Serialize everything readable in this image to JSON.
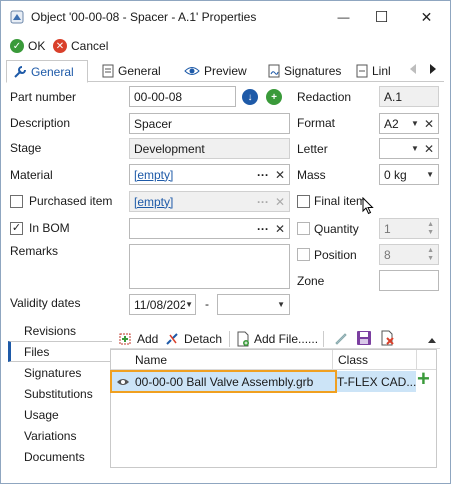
{
  "window": {
    "title": "Object '00-00-08 - Spacer - A.1' Properties",
    "minimize_glyph": "—",
    "maximize_glyph": "☐",
    "close_glyph": "✕"
  },
  "toolbar": {
    "ok_label": "OK",
    "cancel_label": "Cancel"
  },
  "tabs": [
    {
      "label": "General",
      "active": true,
      "icon": "wrench-icon"
    },
    {
      "label": "General",
      "active": false,
      "icon": "document-icon"
    },
    {
      "label": "Preview",
      "active": false,
      "icon": "eye-icon"
    },
    {
      "label": "Signatures",
      "active": false,
      "icon": "signature-icon"
    },
    {
      "label": "Linl",
      "active": false,
      "icon": "link-icon"
    }
  ],
  "form": {
    "part_number_label": "Part number",
    "part_number_value": "00-00-08",
    "description_label": "Description",
    "description_value": "Spacer",
    "stage_label": "Stage",
    "stage_value": "Development",
    "material_label": "Material",
    "material_value": "[empty]",
    "purchased_label": "Purchased item",
    "purchased_value": "[empty]",
    "in_bom_label": "In BOM",
    "remarks_label": "Remarks",
    "validity_label": "Validity dates",
    "validity_from": "11/08/202",
    "validity_sep": "-",
    "ellipsis": "···",
    "redaction_label": "Redaction",
    "redaction_value": "A.1",
    "format_label": "Format",
    "format_value": "A2",
    "letter_label": "Letter",
    "mass_label": "Mass",
    "mass_value": "0 kg",
    "final_label": "Final item",
    "quantity_label": "Quantity",
    "quantity_value": "1",
    "position_label": "Position",
    "position_value": "8",
    "zone_label": "Zone"
  },
  "sidebar": {
    "items": [
      {
        "label": "Revisions",
        "active": false
      },
      {
        "label": "Files",
        "active": true
      },
      {
        "label": "Signatures",
        "active": false
      },
      {
        "label": "Substitutions",
        "active": false
      },
      {
        "label": "Usage",
        "active": false
      },
      {
        "label": "Variations",
        "active": false
      },
      {
        "label": "Documents",
        "active": false
      }
    ]
  },
  "files": {
    "add_label": "Add",
    "detach_label": "Detach",
    "add_file_label": "Add File......",
    "columns": [
      "Name",
      "Class"
    ],
    "rows": [
      {
        "name": "00-00-00 Ball Valve Assembly.grb",
        "class": "T-FLEX CAD..."
      }
    ]
  },
  "colors": {
    "accent": "#1e5aa8",
    "ok_green": "#3a9a3a",
    "cancel_red": "#d9402b",
    "highlight_border": "#f0a020",
    "selected_row": "#cce4f7"
  }
}
